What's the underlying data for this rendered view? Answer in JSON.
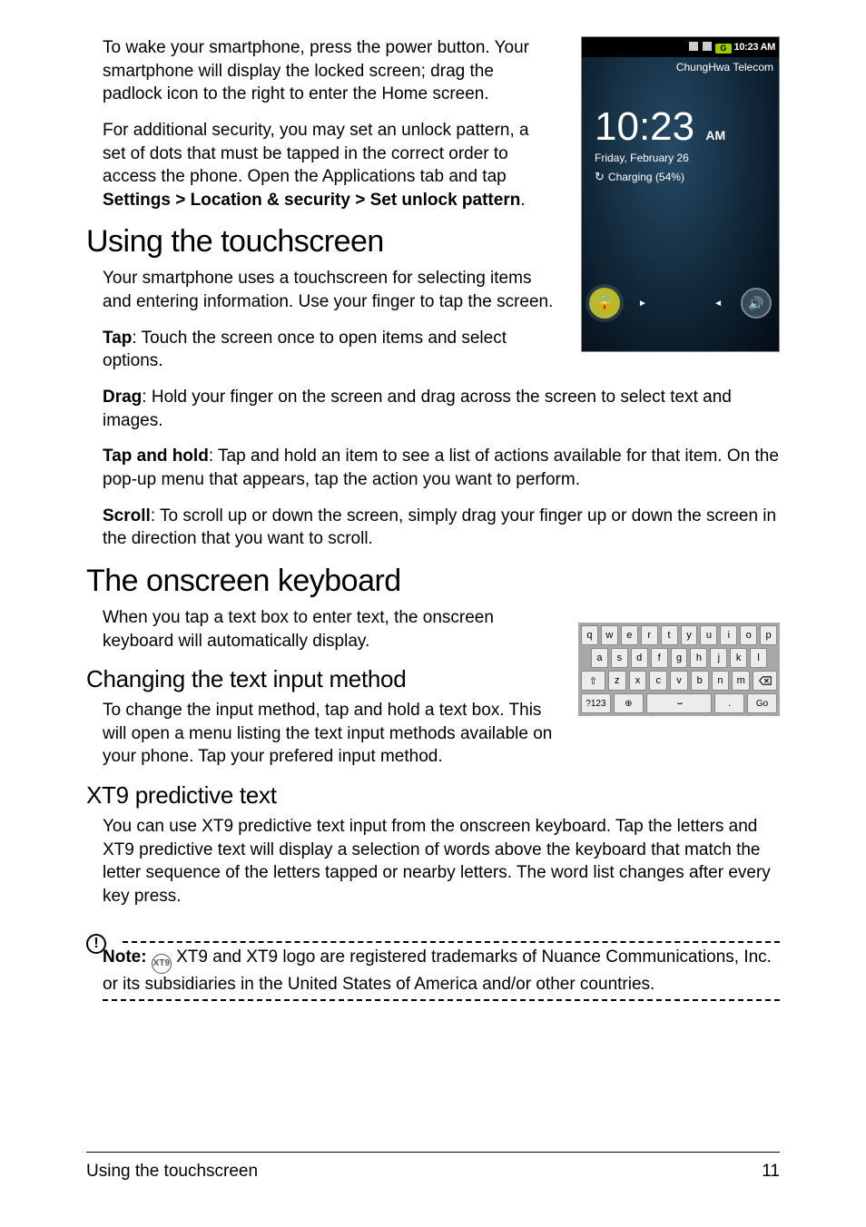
{
  "para": {
    "wake": "To wake your smartphone, press the power button. Your smartphone will display the locked screen; drag the padlock icon to the right to enter the Home screen.",
    "security_pre": "For additional security, you may set an unlock pattern, a set of dots that must be tapped in the correct order to access the phone. Open the Applications tab and tap ",
    "security_bold": "Settings > Location & security > Set unlock pattern",
    "security_post": ".",
    "touch_intro": "Your smartphone uses a touchscreen for selecting items and entering information. Use your finger to tap the screen.",
    "tap_b": "Tap",
    "tap": ": Touch the screen once to open items and select options.",
    "drag_b": "Drag",
    "drag": ": Hold your finger on the screen and drag across the screen to select text and images.",
    "th_b": "Tap and hold",
    "th": ": Tap and hold an item to see a list of actions available for that item. On the pop-up menu that appears, tap the action you want to perform.",
    "scroll_b": "Scroll",
    "scroll": ": To scroll up or down the screen, simply drag your finger up or down the screen in the direction that you want to scroll.",
    "kbd_intro": "When you tap a text box to enter text, the onscreen keyboard will automatically display.",
    "change_input": "To change the input method, tap and hold a text box. This will open a menu listing the text input methods available on your phone. Tap your prefered input method.",
    "xt9": "You can use XT9 predictive text input from the onscreen keyboard. Tap the letters and XT9 predictive text will display a selection of words above the keyboard that match the letter sequence of the letters tapped or nearby letters. The word list changes after every key press."
  },
  "headings": {
    "h1a": "Using the touchscreen",
    "h1b": "The onscreen keyboard",
    "h2a": "Changing the text input method",
    "h2b": "XT9 predictive text"
  },
  "note": {
    "label": "Note:",
    "badge": "XT9",
    "text": " XT9 and XT9 logo are registered trademarks of Nuance Communications, Inc. or its subsidiaries in the United States of America and/or other countries."
  },
  "footer": {
    "left": "Using the touchscreen",
    "right": "11"
  },
  "phone": {
    "status_time": "10:23 AM",
    "status_batt": "G",
    "carrier": "ChungHwa Telecom",
    "clock": "10:23",
    "ampm": "AM",
    "date": "Friday, February 26",
    "charging": "Charging (54%)",
    "lock_glyph": "🔒",
    "sound_glyph": "🔊"
  },
  "keyboard": {
    "row1": [
      "q",
      "w",
      "e",
      "r",
      "t",
      "y",
      "u",
      "i",
      "o",
      "p"
    ],
    "row2": [
      "a",
      "s",
      "d",
      "f",
      "g",
      "h",
      "j",
      "k",
      "l"
    ],
    "row3": [
      "z",
      "x",
      "c",
      "v",
      "b",
      "n",
      "m"
    ],
    "shift": "⇧",
    "num": "?123",
    "globe": "⊕",
    "space": "␣",
    "dot": ".",
    "go": "Go"
  }
}
